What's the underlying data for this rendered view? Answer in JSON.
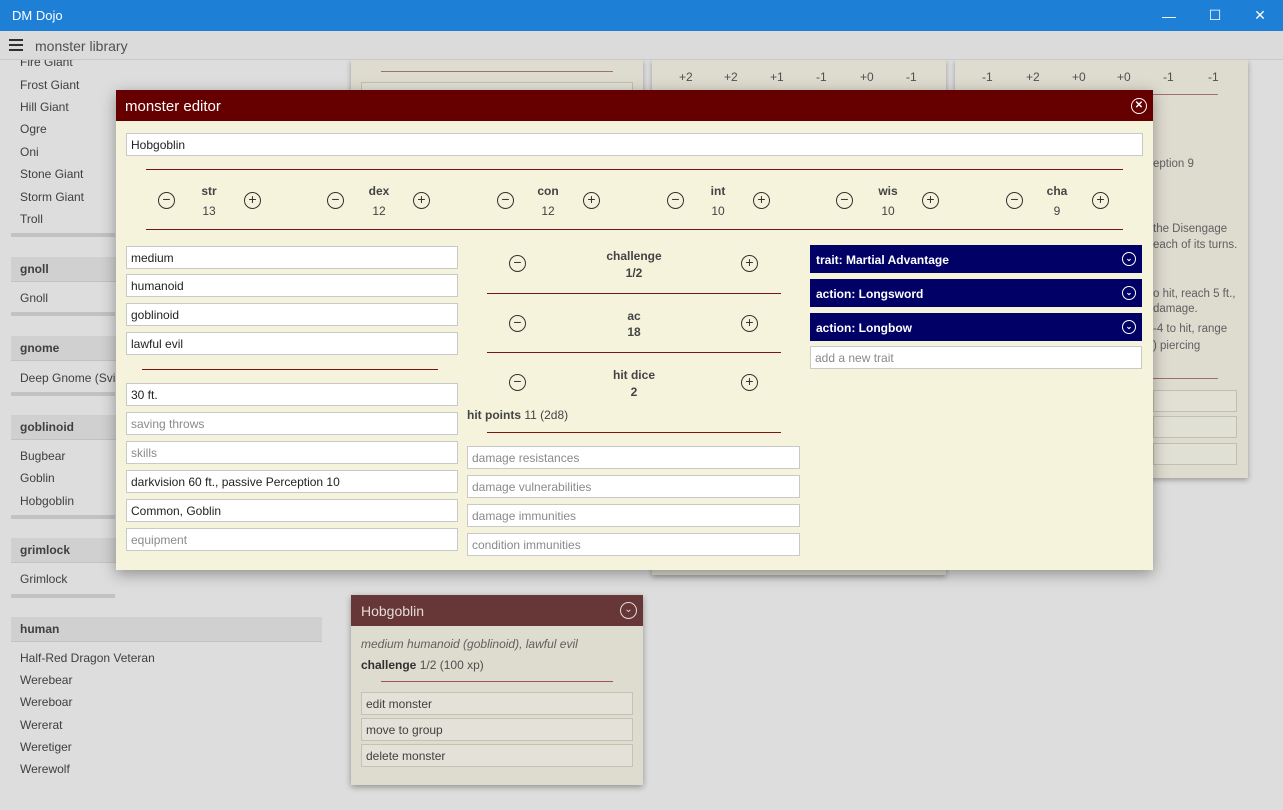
{
  "window": {
    "title": "DM Dojo",
    "minimize": "—",
    "maximize": "☐",
    "close": "✕"
  },
  "appbar": {
    "title": "monster library"
  },
  "library": {
    "giants": [
      "Fire Giant",
      "Frost Giant",
      "Hill Giant",
      "Ogre",
      "Oni",
      "Stone Giant",
      "Storm Giant",
      "Troll"
    ],
    "groups": [
      {
        "header": "gnoll",
        "items": [
          "Gnoll"
        ]
      },
      {
        "header": "gnome",
        "items": [
          "Deep Gnome (Svirfneblin)"
        ]
      },
      {
        "header": "goblinoid",
        "items": [
          "Bugbear",
          "Goblin",
          "Hobgoblin"
        ]
      },
      {
        "header": "grimlock",
        "items": [
          "Grimlock"
        ]
      },
      {
        "header": "human",
        "items": [
          "Half-Red Dragon Veteran",
          "Werebear",
          "Wereboar",
          "Wererat",
          "Weretiger",
          "Werewolf"
        ]
      }
    ]
  },
  "bg_cards": {
    "card2_mods": [
      "+2",
      "+2",
      "+1",
      "-1",
      "+0",
      "-1"
    ],
    "card3_mods": [
      "-1",
      "+2",
      "+0",
      "+0",
      "-1",
      "-1"
    ],
    "card3_texts": [
      "eption 9",
      "the Disengage",
      "each of its turns.",
      "o hit, reach 5 ft.,",
      "damage.",
      "-4 to hit, range",
      ") piercing"
    ]
  },
  "hobgoblin_card": {
    "name": "Hobgoblin",
    "subtitle": "medium humanoid (goblinoid), lawful evil",
    "challenge_label": "challenge",
    "challenge_value": "1/2 (100 xp)",
    "actions": [
      "edit monster",
      "move to group",
      "delete monster"
    ]
  },
  "editor": {
    "title": "monster editor",
    "name": "Hobgoblin",
    "abilities": [
      {
        "name": "str",
        "value": "13"
      },
      {
        "name": "dex",
        "value": "12"
      },
      {
        "name": "con",
        "value": "12"
      },
      {
        "name": "int",
        "value": "10"
      },
      {
        "name": "wis",
        "value": "10"
      },
      {
        "name": "cha",
        "value": "9"
      }
    ],
    "minus_glyph": "−",
    "plus_glyph": "+",
    "left_fields": {
      "size": "medium",
      "type": "humanoid",
      "subtype": "goblinoid",
      "alignment": "lawful evil",
      "speed": "30 ft.",
      "saving_throws_placeholder": "saving throws",
      "skills_placeholder": "skills",
      "senses": "darkvision 60 ft., passive Perception 10",
      "languages": "Common, Goblin",
      "equipment_placeholder": "equipment"
    },
    "challenge": {
      "label": "challenge",
      "value": "1/2"
    },
    "ac": {
      "label": "ac",
      "value": "18"
    },
    "hit_dice": {
      "label": "hit dice",
      "value": "2"
    },
    "hit_points": {
      "label": "hit points",
      "value": "11 (2d8)"
    },
    "damage_fields": {
      "resistances_placeholder": "damage resistances",
      "vulnerabilities_placeholder": "damage vulnerabilities",
      "immunities_placeholder": "damage immunities",
      "condition_immunities_placeholder": "condition immunities"
    },
    "traits": [
      "trait: Martial Advantage",
      "action: Longsword",
      "action: Longbow"
    ],
    "add_trait_placeholder": "add a new trait"
  },
  "colors": {
    "titlebar": "#1d7fd6",
    "modal_header": "#660000",
    "trait_bg": "#000066",
    "modal_bg": "#f5f3dc"
  },
  "icons": {
    "close": "close-circle-icon",
    "chevron": "chevron-down-circle-icon",
    "minus": "minus-circle-icon",
    "plus": "plus-circle-icon",
    "menu": "hamburger-icon"
  }
}
